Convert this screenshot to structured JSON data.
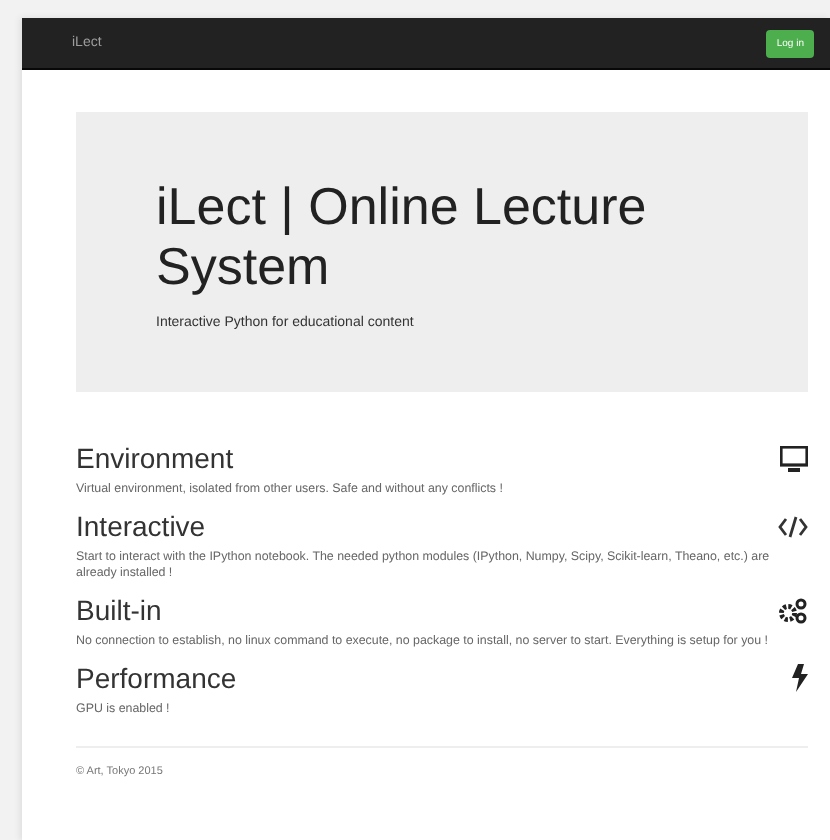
{
  "navbar": {
    "brand": "iLect",
    "login_button": "Log in"
  },
  "jumbotron": {
    "title": "iLect | Online Lecture System",
    "subtitle": "Interactive Python for educational content"
  },
  "features": [
    {
      "title": "Environment",
      "text": "Virtual environment, isolated from other users. Safe and without any conflicts !"
    },
    {
      "title": "Interactive",
      "text": "Start to interact with the IPython notebook. The needed python modules (IPython, Numpy, Scipy, Scikit-learn, Theano, etc.) are already installed !"
    },
    {
      "title": "Built-in",
      "text": "No connection to establish, no linux command to execute, no package to install, no server to start. Everything is setup for you !"
    },
    {
      "title": "Performance",
      "text": "GPU is enabled !"
    }
  ],
  "footer": "© Art, Tokyo 2015"
}
